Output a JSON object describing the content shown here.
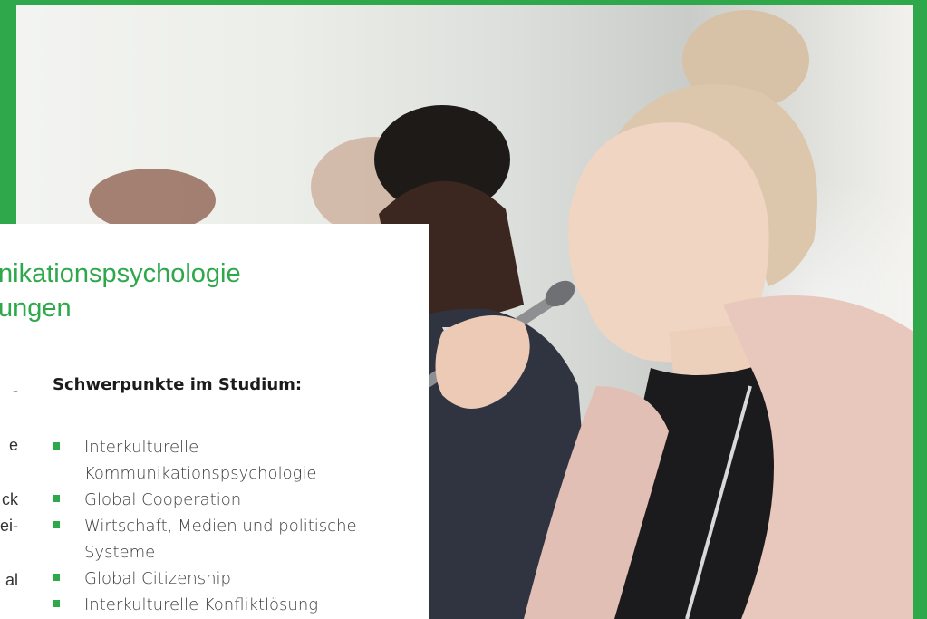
{
  "colors": {
    "accent": "#2ea84a",
    "text": "#3b3b3b",
    "heading": "#1c1c1c"
  },
  "card": {
    "title_line1": "nikationspsychologie",
    "title_line2": "ungen",
    "left_fragments": [
      "-",
      "e",
      "ck",
      "ei-",
      "al"
    ],
    "focus_heading": "Schwerpunkte im Studium:",
    "focus_items": [
      "Interkulturelle Kommunikationspsychologie",
      "Global Cooperation",
      "Wirtschaft, Medien und politische Systeme",
      "Global Citizenship",
      "Interkulturelle Konfliktlösung"
    ]
  }
}
